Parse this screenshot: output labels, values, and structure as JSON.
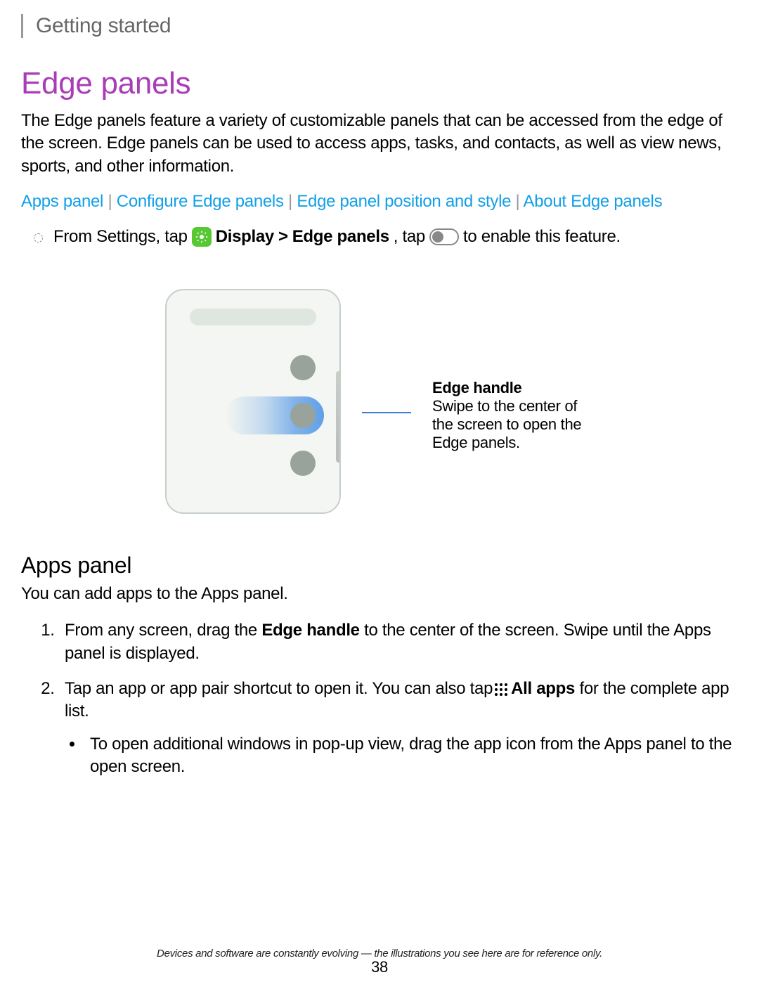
{
  "header": "Getting started",
  "title": "Edge panels",
  "intro": "The Edge panels feature a variety of customizable panels that can be accessed from the edge of the screen. Edge panels can be used to access apps, tasks, and contacts, as well as view news, sports, and other information.",
  "links": {
    "a": "Apps panel",
    "b": "Configure Edge panels",
    "c": "Edge panel position and style",
    "d": "About Edge panels",
    "sep": " | "
  },
  "instruction": {
    "pre": "From Settings, tap ",
    "display": "Display",
    "arrow": " > ",
    "edge": "Edge panels",
    "mid": ", tap ",
    "post": " to enable this feature."
  },
  "callout": {
    "title": "Edge handle",
    "body": "Swipe to the center of the screen to open the Edge panels."
  },
  "apps_panel": {
    "title": "Apps panel",
    "intro": "You can add apps to the Apps panel.",
    "step1_pre": "From any screen, drag the ",
    "step1_bold": "Edge handle",
    "step1_post": " to the center of the screen. Swipe until the Apps panel is displayed.",
    "step2_pre": "Tap an app or app pair shortcut to open it. You can also tap",
    "step2_bold": "All apps",
    "step2_post": " for the complete app list.",
    "sub": "To open additional windows in pop-up view, drag the app icon from the Apps panel to the open screen."
  },
  "footer": "Devices and software are constantly evolving — the illustrations you see here are for reference only.",
  "page": "38"
}
